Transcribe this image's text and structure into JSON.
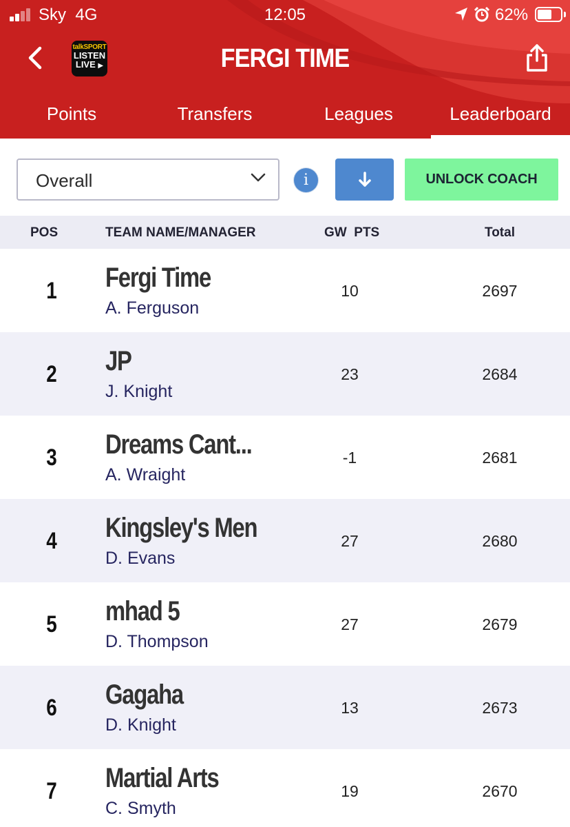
{
  "status_bar": {
    "carrier": "Sky",
    "network": "4G",
    "time": "12:05",
    "battery_percent": "62%",
    "battery_level": 0.62
  },
  "header": {
    "title": "FERGI TIME",
    "logo": {
      "line1": "talkSPORT",
      "line2": "LISTEN",
      "line3": "LIVE"
    },
    "back_icon": "chevron-left-icon",
    "share_icon": "share-icon"
  },
  "tabs": [
    {
      "label": "Points"
    },
    {
      "label": "Transfers"
    },
    {
      "label": "Leagues"
    },
    {
      "label": "Leaderboard",
      "active": true
    }
  ],
  "controls": {
    "filter_value": "Overall",
    "info_label": "i",
    "download_icon": "arrow-down-icon",
    "coach_button": "UNLOCK COACH"
  },
  "table": {
    "columns": {
      "pos": "POS",
      "team": "TEAM NAME/MANAGER",
      "gw": "GW  PTS",
      "total": "Total"
    },
    "rows": [
      {
        "pos": "1",
        "team": "Fergi Time",
        "manager": "A. Ferguson",
        "gw": "10",
        "total": "2697"
      },
      {
        "pos": "2",
        "team": "JP",
        "manager": "J. Knight",
        "gw": "23",
        "total": "2684"
      },
      {
        "pos": "3",
        "team": "Dreams Cant...",
        "manager": "A. Wraight",
        "gw": "-1",
        "total": "2681"
      },
      {
        "pos": "4",
        "team": "Kingsley's Men",
        "manager": "D. Evans",
        "gw": "27",
        "total": "2680"
      },
      {
        "pos": "5",
        "team": "mhad 5",
        "manager": "D. Thompson",
        "gw": "27",
        "total": "2679"
      },
      {
        "pos": "6",
        "team": "Gagaha",
        "manager": "D. Knight",
        "gw": "13",
        "total": "2673"
      },
      {
        "pos": "7",
        "team": "Martial Arts",
        "manager": "C. Smyth",
        "gw": "19",
        "total": "2670"
      }
    ]
  },
  "colors": {
    "header_red": "#c8201f",
    "header_light": "#e5413d",
    "accent_blue": "#4e88cf",
    "coach_green": "#7ef59d",
    "row_alt": "#f0f0f8"
  }
}
